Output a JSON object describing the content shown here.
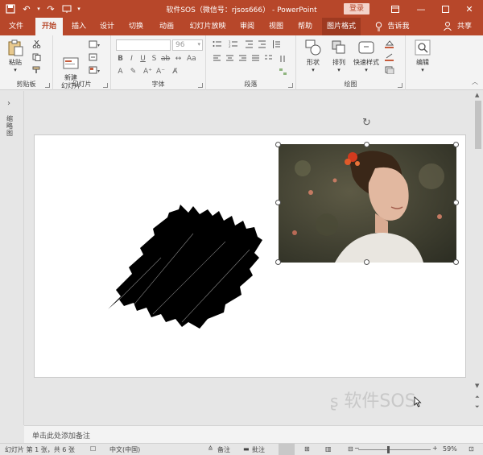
{
  "titlebar": {
    "title": "软件SOS（微信号：rjsos666） -  PowerPoint",
    "login": "登录"
  },
  "tabs": [
    {
      "label": "文件"
    },
    {
      "label": "开始"
    },
    {
      "label": "插入"
    },
    {
      "label": "设计"
    },
    {
      "label": "切换"
    },
    {
      "label": "动画"
    },
    {
      "label": "幻灯片放映"
    },
    {
      "label": "审阅"
    },
    {
      "label": "视图"
    },
    {
      "label": "帮助"
    },
    {
      "label": "图片格式"
    },
    {
      "label": "告诉我"
    },
    {
      "label": "共享"
    }
  ],
  "ribbon": {
    "clipboard": {
      "paste": "粘贴",
      "group": "剪贴板"
    },
    "slides": {
      "new_slide": "新建\n幻灯片",
      "group": "幻灯片"
    },
    "font": {
      "size": "96",
      "group": "字体"
    },
    "paragraph": {
      "group": "段落"
    },
    "drawing": {
      "shapes": "形状",
      "arrange": "排列",
      "quick_styles": "快速样式",
      "group": "绘图"
    },
    "editing": {
      "edit": "编辑"
    }
  },
  "left_pane": {
    "label": "缩略图"
  },
  "notes": {
    "placeholder": "单击此处添加备注"
  },
  "status": {
    "slide_info": "幻灯片 第 1 张，共 6 张",
    "language": "中文(中国)",
    "notes": "备注",
    "comments": "批注",
    "zoom": "59%"
  },
  "watermark": "软件SOS",
  "colors": {
    "accent": "#b7472a"
  }
}
